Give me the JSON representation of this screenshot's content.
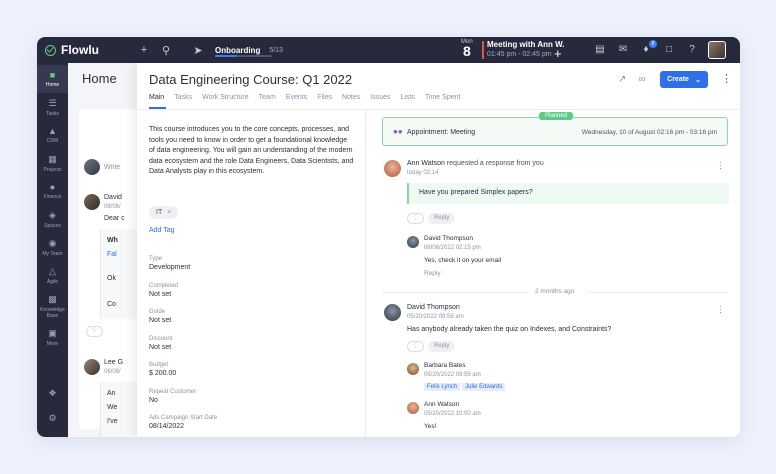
{
  "topbar": {
    "brand": "Flowlu",
    "onboarding_label": "Onboarding",
    "onboarding_count": "5/13",
    "onboarding_progress": 0.38,
    "date_day": "Mon",
    "date_num": "8",
    "meeting_title": "Meeting with Ann W.",
    "meeting_time": "01:45 pm - 02:45 pm",
    "notification_count": "8"
  },
  "sidebar": {
    "items": [
      {
        "label": "Home",
        "icon": "home-icon"
      },
      {
        "label": "Tasks",
        "icon": "tasks-icon"
      },
      {
        "label": "CRM",
        "icon": "crm-icon"
      },
      {
        "label": "Projects",
        "icon": "projects-icon"
      },
      {
        "label": "Finance",
        "icon": "finance-icon"
      },
      {
        "label": "Spaces",
        "icon": "spaces-icon"
      },
      {
        "label": "My Team",
        "icon": "team-icon"
      },
      {
        "label": "Agile",
        "icon": "agile-icon"
      },
      {
        "label": "Knowledge Base",
        "icon": "knowledge-icon"
      },
      {
        "label": "More",
        "icon": "more-icon"
      }
    ]
  },
  "home": {
    "title": "Home",
    "write_placeholder": "Write",
    "post1_name": "David",
    "post1_date": "08/08/",
    "post1_text": "Dear c",
    "post1_box_l1": "Wh",
    "post1_box_l2": "Fal",
    "post1_box_l3": "Ok",
    "post1_box_l4": "Co",
    "post2_name": "Lee G",
    "post2_date": "06/08/",
    "post2_box_l1": "An",
    "post2_box_l2": "We",
    "post2_box_l3": "I've"
  },
  "panel": {
    "title": "Data Engineering Course: Q1 2022",
    "create_label": "Create",
    "tabs": [
      "Main",
      "Tasks",
      "Work Structure",
      "Team",
      "Events",
      "Files",
      "Notes",
      "Issues",
      "Lists",
      "Time Spent"
    ],
    "description": "This course introduces you to the core concepts, processes, and tools you need to know in order to get a foundational knowledge of data engineering. You will gain an understanding of the modern data ecosystem and the role Data Engineers, Data Scientists, and Data Analysts play in this ecosystem.",
    "tag": "IT",
    "add_tag": "Add Tag",
    "fields": [
      {
        "label": "Type",
        "value": "Development"
      },
      {
        "label": "Completed",
        "value": "Not set"
      },
      {
        "label": "Guide",
        "value": "Not set"
      },
      {
        "label": "Discount",
        "value": "Not set"
      },
      {
        "label": "Budget",
        "value": "$ 200.00"
      },
      {
        "label": "Repeat Customer",
        "value": "No"
      },
      {
        "label": "Ads Campaign Start Date",
        "value": "08/14/2022"
      }
    ]
  },
  "activity": {
    "planned_badge": "Planned",
    "appointment_title": "Appointment: Meeting",
    "appointment_date": "Wednesday, 10 of August 02:16 pm - 03:16 pm",
    "m1_name": "Ann Watson",
    "m1_action": "requested a response from you",
    "m1_time": "today 02:14",
    "m1_question": "Have you prepared Simplex papers?",
    "reply_label": "Reply",
    "r1_name": "David Thompson",
    "r1_time": "08/08/2022 02:15 pm",
    "r1_text": "Yes, check it on your email",
    "divider": "2 months ago",
    "m2_name": "David Thompson",
    "m2_time": "05/20/2022 09:58 am",
    "m2_text": "Has anybody already taken the quiz on Indexes, and Constraints?",
    "r2_name": "Barbara Bates",
    "r2_time": "05/20/2022 09:59 am",
    "r2_mention1": "Felix Lynch",
    "r2_mention2": "Julie Edwards",
    "r3_name": "Ann Watson",
    "r3_time": "05/20/2022 10:00 am",
    "r3_text": "Yes!"
  }
}
